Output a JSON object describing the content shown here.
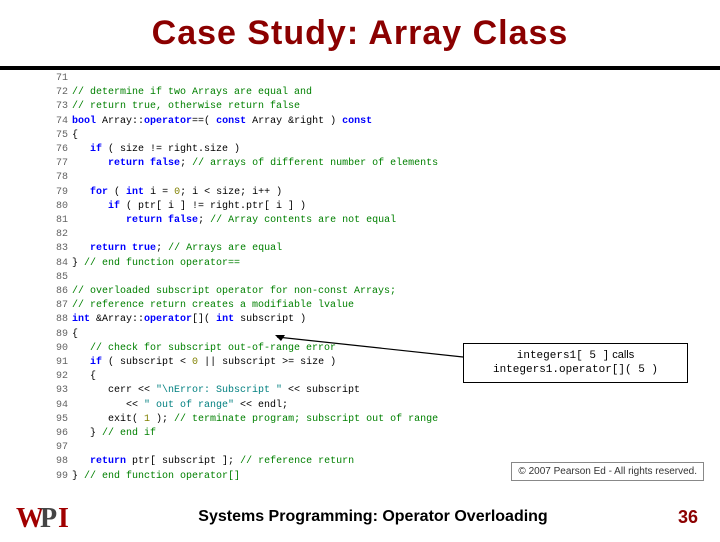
{
  "title": "Case Study: Array Class",
  "footer": {
    "text": "Systems Programming:  Operator Overloading",
    "page": "36"
  },
  "callout": {
    "l1a": "integers1[ 5 ]",
    "l1b": " calls",
    "l2": "integers1.operator[]( 5 )"
  },
  "copyright": "© 2007 Pearson Ed - All rights reserved.",
  "code": [
    {
      "n": "71",
      "h": ""
    },
    {
      "n": "72",
      "h": "<span class='cmt'>// determine if two Arrays are equal and</span>"
    },
    {
      "n": "73",
      "h": "<span class='cmt'>// return true, otherwise return false</span>"
    },
    {
      "n": "74",
      "h": "<span class='kw'>bool</span> Array::<span class='kw'>operator</span>==( <span class='kw'>const</span> Array &amp;right ) <span class='kw'>const</span>"
    },
    {
      "n": "75",
      "h": "{"
    },
    {
      "n": "76",
      "h": "   <span class='kw'>if</span> ( size != right.size )"
    },
    {
      "n": "77",
      "h": "      <span class='kw'>return</span> <span class='kw'>false</span>; <span class='cmt'>// arrays of different number of elements</span>"
    },
    {
      "n": "78",
      "h": ""
    },
    {
      "n": "79",
      "h": "   <span class='kw'>for</span> ( <span class='kw'>int</span> i = <span class='num'>0</span>; i &lt; size; i++ )"
    },
    {
      "n": "80",
      "h": "      <span class='kw'>if</span> ( ptr[ i ] != right.ptr[ i ] )"
    },
    {
      "n": "81",
      "h": "         <span class='kw'>return</span> <span class='kw'>false</span>; <span class='cmt'>// Array contents are not equal</span>"
    },
    {
      "n": "82",
      "h": ""
    },
    {
      "n": "83",
      "h": "   <span class='kw'>return</span> <span class='kw'>true</span>; <span class='cmt'>// Arrays are equal</span>"
    },
    {
      "n": "84",
      "h": "} <span class='cmt'>// end function operator==</span>"
    },
    {
      "n": "85",
      "h": ""
    },
    {
      "n": "86",
      "h": "<span class='cmt'>// overloaded subscript operator for non-const Arrays;</span>"
    },
    {
      "n": "87",
      "h": "<span class='cmt'>// reference return creates a modifiable lvalue</span>"
    },
    {
      "n": "88",
      "h": "<span class='kw'>int</span> &amp;Array::<span class='kw'>operator</span>[]( <span class='kw'>int</span> subscript )"
    },
    {
      "n": "89",
      "h": "{"
    },
    {
      "n": "90",
      "h": "   <span class='cmt'>// check for subscript out-of-range error</span>"
    },
    {
      "n": "91",
      "h": "   <span class='kw'>if</span> ( subscript &lt; <span class='num'>0</span> || subscript &gt;= size )"
    },
    {
      "n": "92",
      "h": "   {"
    },
    {
      "n": "93",
      "h": "      cerr &lt;&lt; <span class='str'>\"\\nError: Subscript \"</span> &lt;&lt; subscript"
    },
    {
      "n": "94",
      "h": "         &lt;&lt; <span class='str'>\" out of range\"</span> &lt;&lt; endl;"
    },
    {
      "n": "95",
      "h": "      exit( <span class='num'>1</span> ); <span class='cmt'>// terminate program; subscript out of range</span>"
    },
    {
      "n": "96",
      "h": "   } <span class='cmt'>// end if</span>"
    },
    {
      "n": "97",
      "h": ""
    },
    {
      "n": "98",
      "h": "   <span class='kw'>return</span> ptr[ subscript ]; <span class='cmt'>// reference return</span>"
    },
    {
      "n": "99",
      "h": "} <span class='cmt'>// end function operator[]</span>"
    }
  ]
}
